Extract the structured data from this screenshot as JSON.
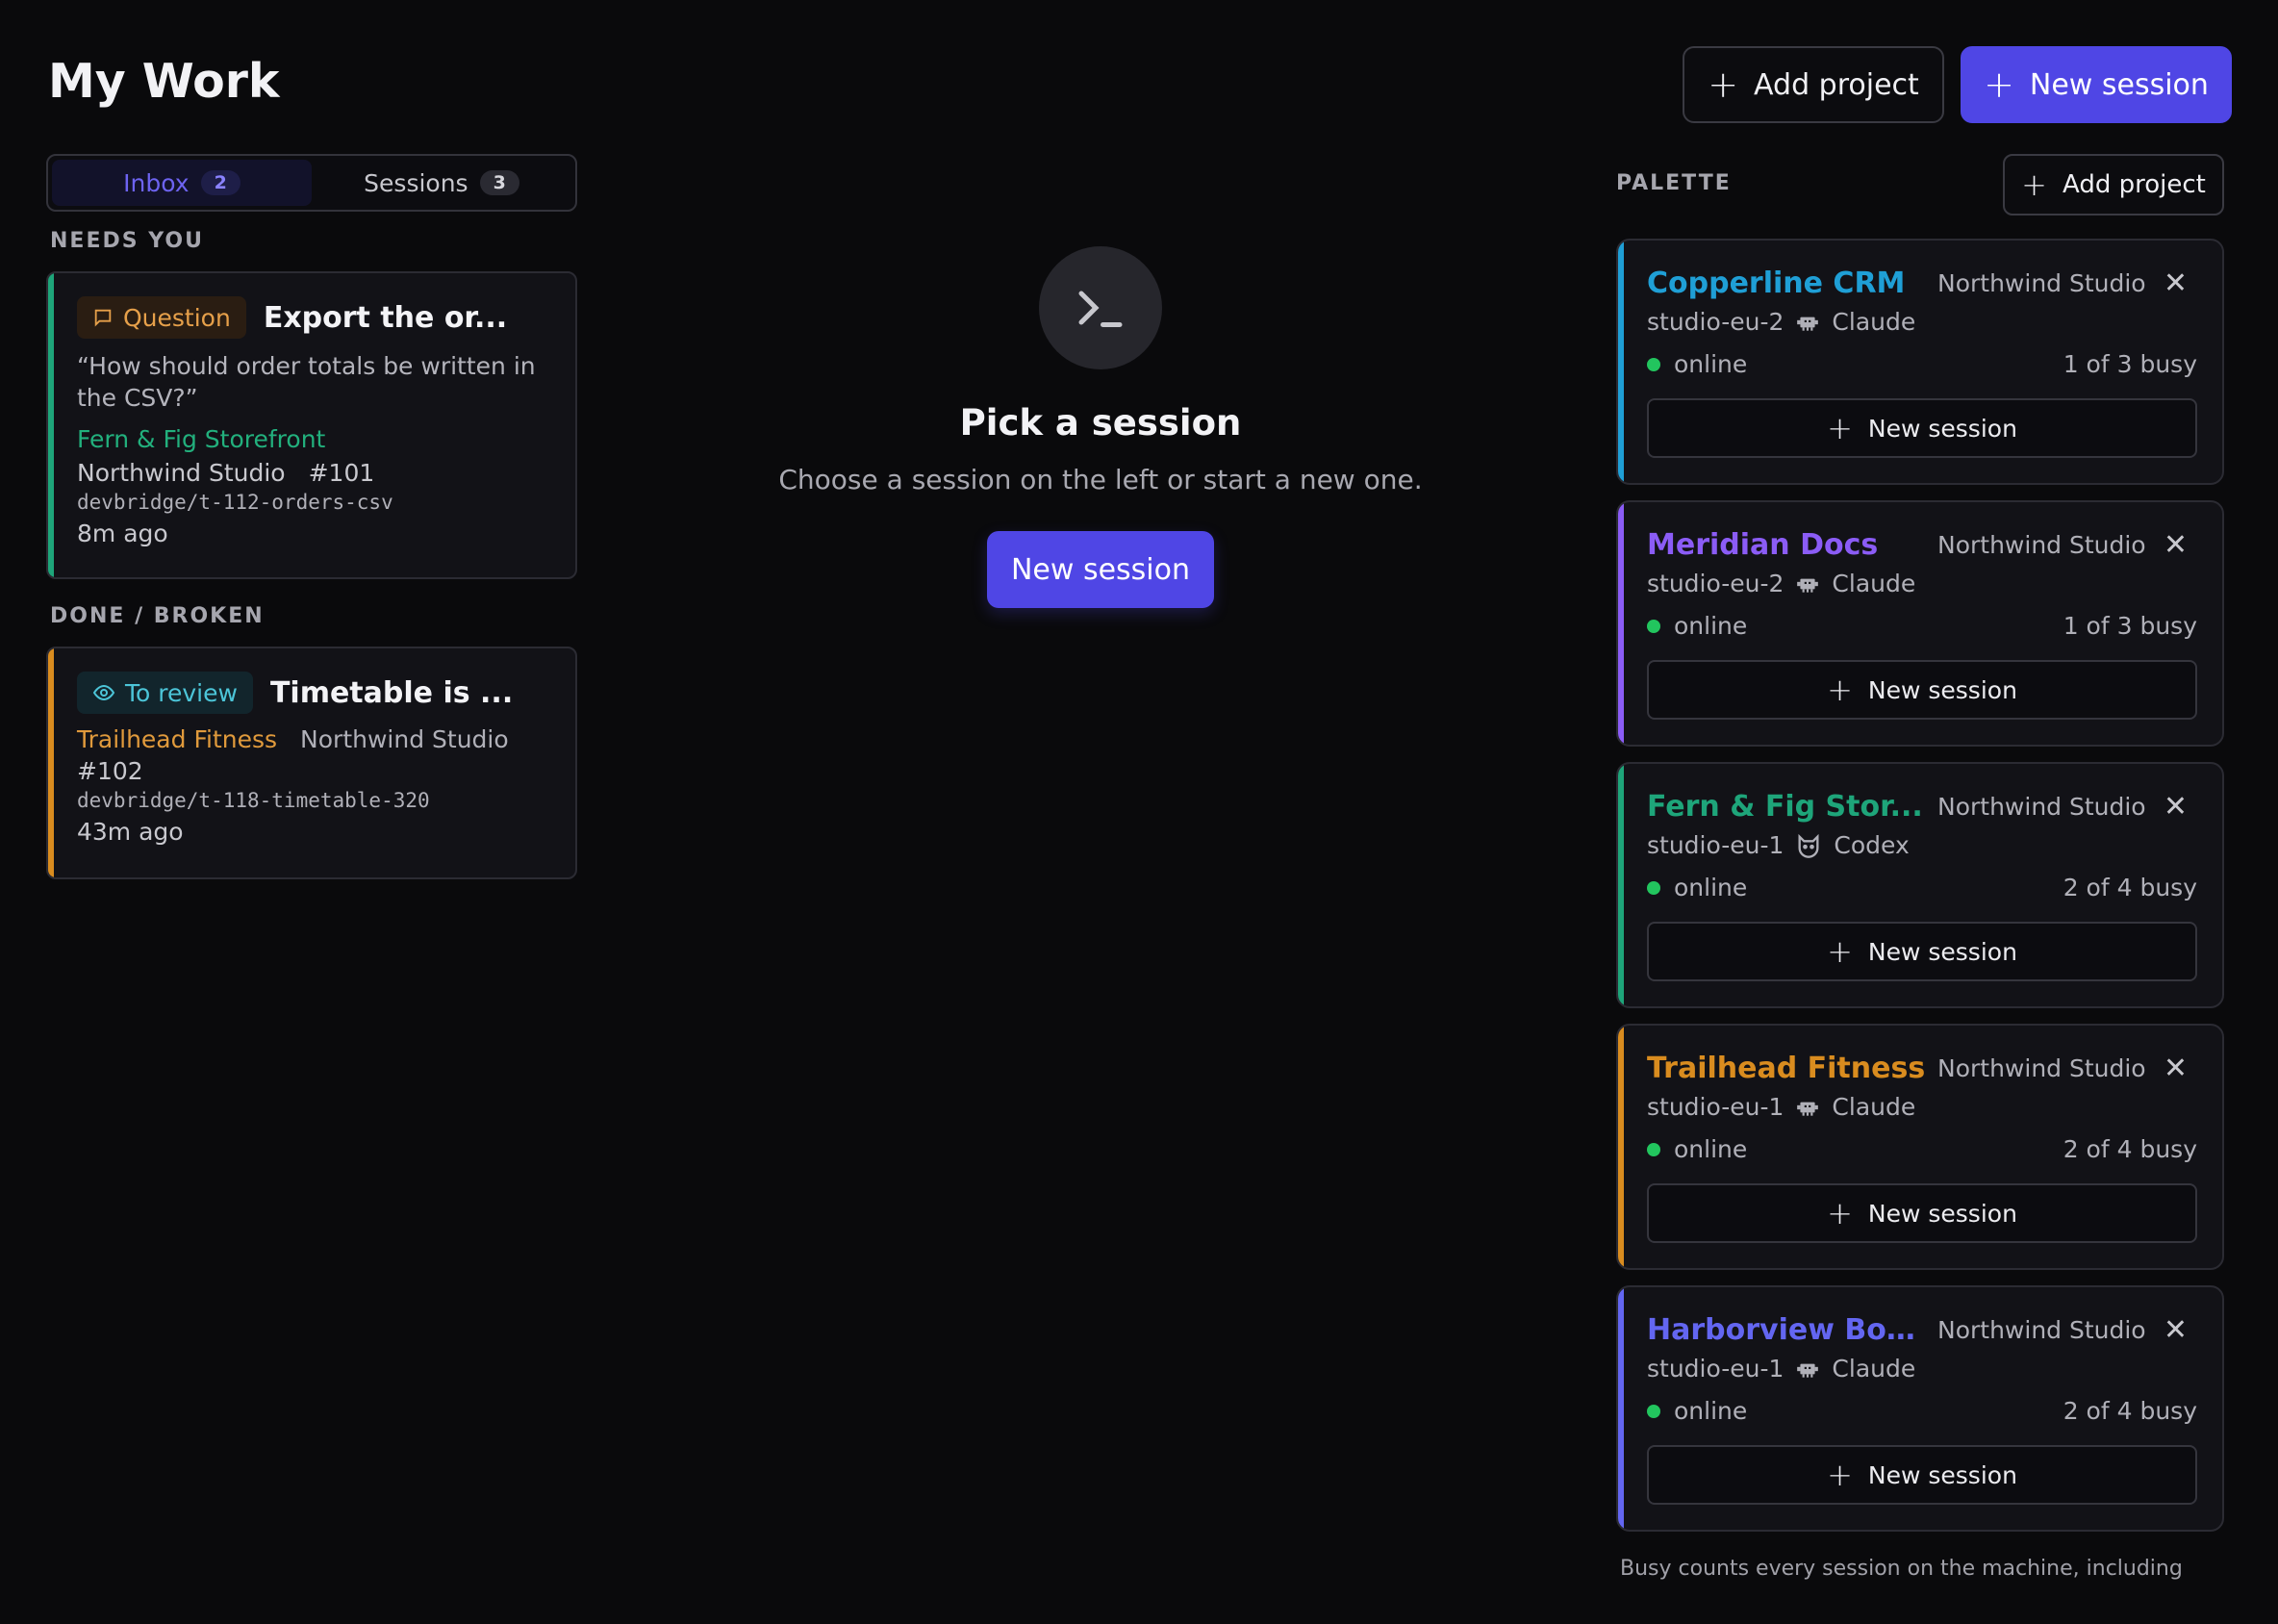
{
  "header": {
    "title": "My Work",
    "add_project_label": "Add project",
    "new_session_label": "New session"
  },
  "tabs": [
    {
      "label": "Inbox",
      "count": "2"
    },
    {
      "label": "Sessions",
      "count": "3"
    }
  ],
  "sections": {
    "needs_you": "NEEDS YOU",
    "done_broken": "DONE / BROKEN"
  },
  "inbox": [
    {
      "badge": "Question",
      "title": "Export the or...",
      "quote": "“How should order totals be written in the CSV?”",
      "project": "Fern & Fig Storefront",
      "org": "Northwind Studio",
      "number": "#101",
      "branch": "devbridge/t-112-orders-csv",
      "ago": "8m ago"
    },
    {
      "badge": "To review",
      "title": "Timetable is ...",
      "project": "Trailhead Fitness",
      "org": "Northwind Studio",
      "number": "#102",
      "branch": "devbridge/t-118-timetable-320",
      "ago": "43m ago"
    }
  ],
  "empty_state": {
    "title": "Pick a session",
    "subtitle": "Choose a session on the left or start a new one.",
    "button": "New session"
  },
  "palette": {
    "label": "PALETTE",
    "add_project_label": "Add project",
    "projects": [
      {
        "name": "Copperline CRM",
        "org": "Northwind Studio",
        "machine": "studio-eu-2",
        "agent": "Claude",
        "status": "online",
        "busy": "1 of 3 busy",
        "button": "New session",
        "accent": "#1f9fd6"
      },
      {
        "name": "Meridian Docs",
        "org": "Northwind Studio",
        "machine": "studio-eu-2",
        "agent": "Claude",
        "status": "online",
        "busy": "1 of 3 busy",
        "button": "New session",
        "accent": "#8b5cf6"
      },
      {
        "name": "Fern & Fig Stor...",
        "org": "Northwind Studio",
        "machine": "studio-eu-1",
        "agent": "Codex",
        "status": "online",
        "busy": "2 of 4 busy",
        "button": "New session",
        "accent": "#1ea57a"
      },
      {
        "name": "Trailhead Fitness",
        "org": "Northwind Studio",
        "machine": "studio-eu-1",
        "agent": "Claude",
        "status": "online",
        "busy": "2 of 4 busy",
        "button": "New session",
        "accent": "#d98c1f"
      },
      {
        "name": "Harborview Boo...",
        "org": "Northwind Studio",
        "machine": "studio-eu-1",
        "agent": "Claude",
        "status": "online",
        "busy": "2 of 4 busy",
        "button": "New session",
        "accent": "#6366f1"
      }
    ],
    "footnote": "Busy counts every session on the machine, including"
  },
  "colors": {
    "primary": "#4f46e5",
    "background": "#0a0a0c",
    "online": "#22c55e"
  },
  "icons": {
    "plus": "plus-icon",
    "close": "close-icon",
    "question": "message-square-icon",
    "review": "eye-icon",
    "terminal": "terminal-icon",
    "claude": "robot-icon",
    "codex": "cat-icon"
  }
}
